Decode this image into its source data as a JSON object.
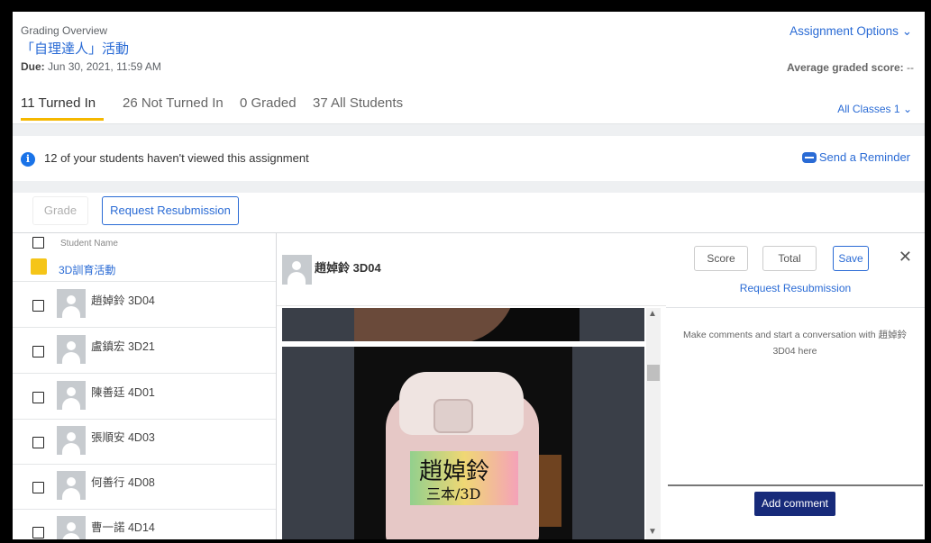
{
  "header": {
    "breadcrumb": "Grading Overview",
    "title": "「自理達人」活動",
    "due_label": "Due:",
    "due_value": "Jun 30, 2021, 11:59 AM",
    "assignment_options": "Assignment Options",
    "avg_label": "Average graded score:",
    "avg_value": "--"
  },
  "tabs": [
    {
      "label": "11 Turned In",
      "active": true
    },
    {
      "label": "26 Not Turned In",
      "active": false
    },
    {
      "label": "0 Graded",
      "active": false
    },
    {
      "label": "37 All Students",
      "active": false
    }
  ],
  "filter": {
    "label": "All Classes",
    "count": "1"
  },
  "banner": {
    "text": "12 of your students haven't viewed this assignment",
    "action": "Send a Reminder"
  },
  "toolbar": {
    "grade_label": "Grade",
    "resubmission_label": "Request Resubmission"
  },
  "list": {
    "header_label": "Student Name",
    "group_label": "3D訓育活動",
    "group_color": "#f5c518",
    "students": [
      {
        "name": "趙婥鈴 3D04"
      },
      {
        "name": "盧鎮宏 3D21"
      },
      {
        "name": "陳善廷 4D01"
      },
      {
        "name": "張順安 4D03"
      },
      {
        "name": "何善行 4D08"
      },
      {
        "name": "曹一諾 4D14"
      }
    ]
  },
  "preview": {
    "student_name": "趙婥鈴 3D04",
    "photo_label_line1": "趙婥鈴",
    "photo_label_line2": "三本/3D"
  },
  "comments": {
    "score_label": "Score",
    "total_label": "Total",
    "save_label": "Save",
    "close_icon": "close-icon",
    "resubmission_label": "Request Resubmission",
    "prompt": "Make comments and start a conversation with 趙婥鈴 3D04 here",
    "add_label": "Add comment"
  },
  "colors": {
    "accent": "#2a6bd5",
    "tab_underline": "#f5b800",
    "add_button": "#172a7a"
  }
}
